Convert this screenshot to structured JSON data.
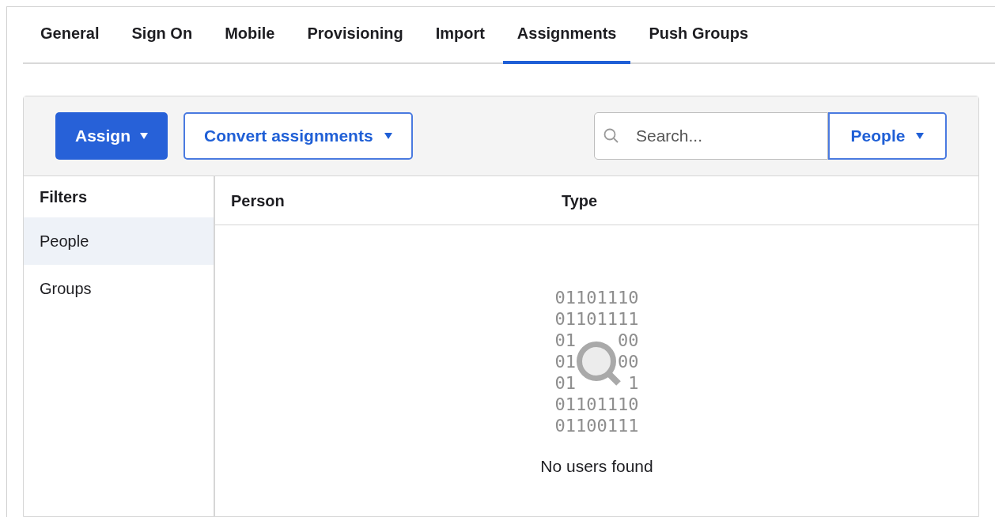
{
  "tabs": [
    {
      "label": "General",
      "selected": false
    },
    {
      "label": "Sign On",
      "selected": false
    },
    {
      "label": "Mobile",
      "selected": false
    },
    {
      "label": "Provisioning",
      "selected": false
    },
    {
      "label": "Import",
      "selected": false
    },
    {
      "label": "Assignments",
      "selected": true
    },
    {
      "label": "Push Groups",
      "selected": false
    }
  ],
  "toolbar": {
    "assign_button": "Assign",
    "convert_button": "Convert assignments",
    "search": {
      "placeholder": "Search..."
    },
    "scope_dropdown": "People"
  },
  "filters": {
    "title": "Filters",
    "items": [
      {
        "label": "People",
        "selected": true
      },
      {
        "label": "Groups",
        "selected": false
      }
    ]
  },
  "table": {
    "columns": [
      "Person",
      "Type"
    ],
    "empty_state": {
      "binary_lines": [
        {
          "segments": [
            "01101110"
          ]
        },
        {
          "segments": [
            "01101111"
          ]
        },
        {
          "segments": [
            "01",
            "00"
          ]
        },
        {
          "segments": [
            "01",
            "00"
          ]
        },
        {
          "segments": [
            "01",
            "1"
          ]
        },
        {
          "segments": [
            "01101110"
          ]
        },
        {
          "segments": [
            "01100111"
          ]
        }
      ],
      "message": "No users found"
    }
  }
}
